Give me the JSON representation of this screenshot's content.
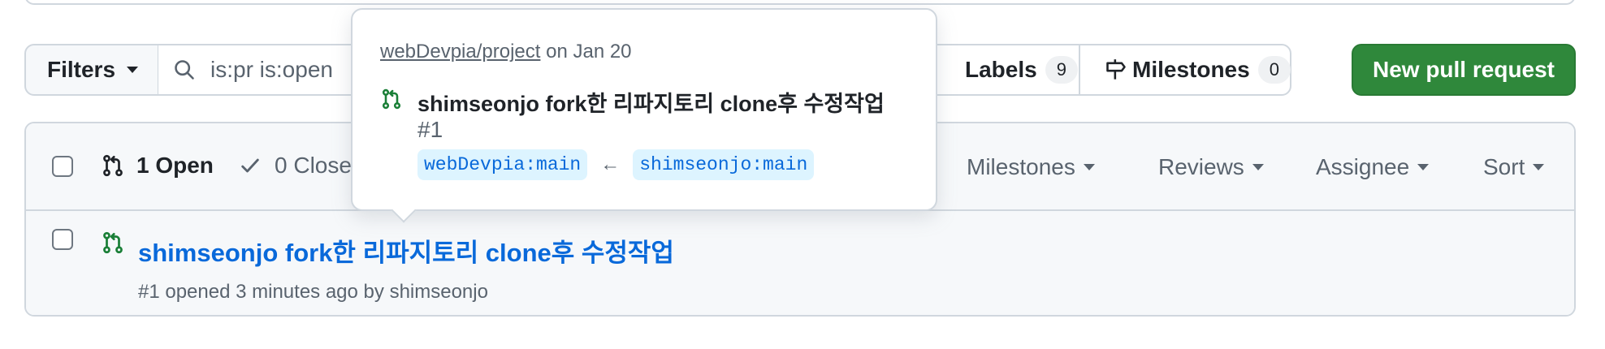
{
  "filters": {
    "filters_label": "Filters",
    "search_value": "is:pr is:open",
    "labels_label": "Labels",
    "labels_count": "9",
    "milestones_label": "Milestones",
    "milestones_count": "0",
    "new_pr_label": "New pull request"
  },
  "list_header": {
    "open_label": "1 Open",
    "closed_label": "0 Close",
    "milestones_filter": "Milestones",
    "reviews_filter": "Reviews",
    "assignee_filter": "Assignee",
    "sort_filter": "Sort"
  },
  "pull_requests": [
    {
      "title": "shimseonjo fork한 리파지토리 clone후 수정작업",
      "meta": "#1 opened 3 minutes ago by shimseonjo"
    }
  ],
  "popover": {
    "repo": "webDevpia/project",
    "date_text": " on Jan 20",
    "title": "shimseonjo fork한 리파지토리 clone후 수정작업",
    "number": "#1",
    "base_branch": "webDevpia:main",
    "head_branch": "shimseonjo:main",
    "arrow": "←"
  },
  "colors": {
    "open_icon": "#1a7f37",
    "primary_button": "#2f883b",
    "link": "#0969da"
  }
}
